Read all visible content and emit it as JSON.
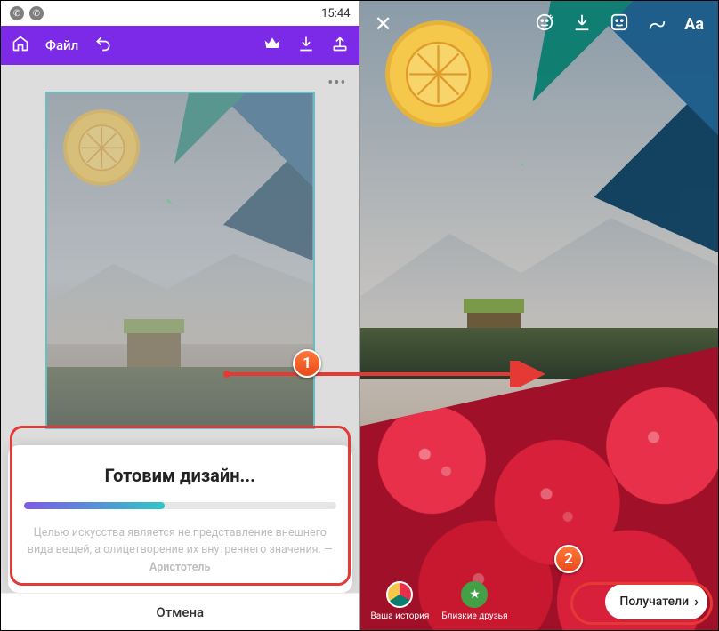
{
  "statusbar_left": {
    "time": "15:44"
  },
  "appbar_left": {
    "file_label": "Файл"
  },
  "sheet": {
    "title": "Готовим дизайн...",
    "quote_text": "Целью искусства является не представление внешнего вида вещей, а олицетворение их внутреннего значения. —",
    "quote_author": "Аристотель",
    "progress_percent": 45
  },
  "cancel_label": "Отмена",
  "right_toolbar": {
    "text_tool": "Aa"
  },
  "story_options": {
    "your_story": "Ваша история",
    "close_friends": "Близкие друзья"
  },
  "recipients_button": "Получатели",
  "badges": {
    "one": "1",
    "two": "2"
  }
}
